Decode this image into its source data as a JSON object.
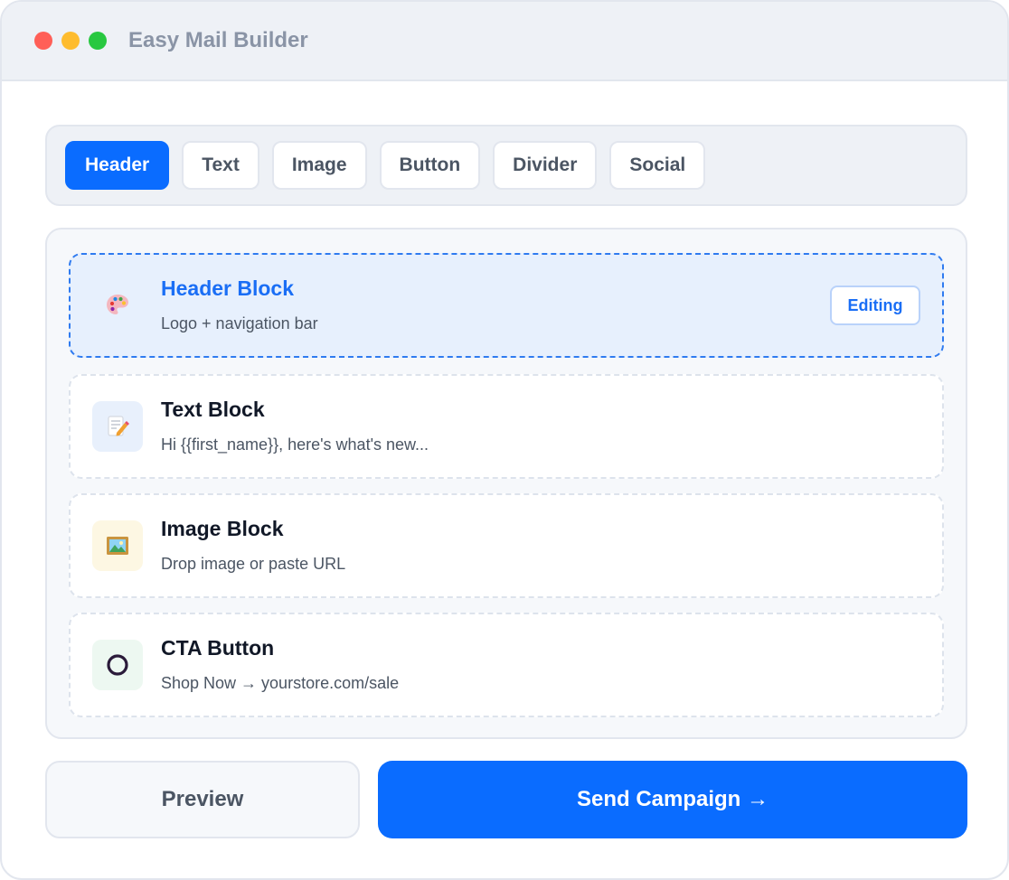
{
  "window": {
    "title": "Easy Mail Builder"
  },
  "tabs": [
    {
      "label": "Header",
      "active": true
    },
    {
      "label": "Text",
      "active": false
    },
    {
      "label": "Image",
      "active": false
    },
    {
      "label": "Button",
      "active": false
    },
    {
      "label": "Divider",
      "active": false
    },
    {
      "label": "Social",
      "active": false
    }
  ],
  "blocks": [
    {
      "title": "Header Block",
      "subtitle": "Logo + navigation bar",
      "icon": "palette-icon",
      "badge": "Editing",
      "selected": true
    },
    {
      "title": "Text Block",
      "subtitle": "Hi {{first_name}}, here's what's new...",
      "icon": "memo-pencil-icon",
      "selected": false
    },
    {
      "title": "Image Block",
      "subtitle": "Drop image or paste URL",
      "icon": "framed-picture-icon",
      "selected": false
    },
    {
      "title": "CTA Button",
      "subtitle": "Shop Now → yourstore.com/sale",
      "icon": "ring-icon",
      "selected": false
    }
  ],
  "actions": {
    "preview_label": "Preview",
    "send_label": "Send Campaign →"
  },
  "colors": {
    "accent": "#0a6cff",
    "selected_block_bg": "#e7f0fd",
    "text_icon_bg": "#e8f0fc",
    "image_icon_bg": "#fdf7e3",
    "cta_icon_bg": "#edf8f1"
  }
}
